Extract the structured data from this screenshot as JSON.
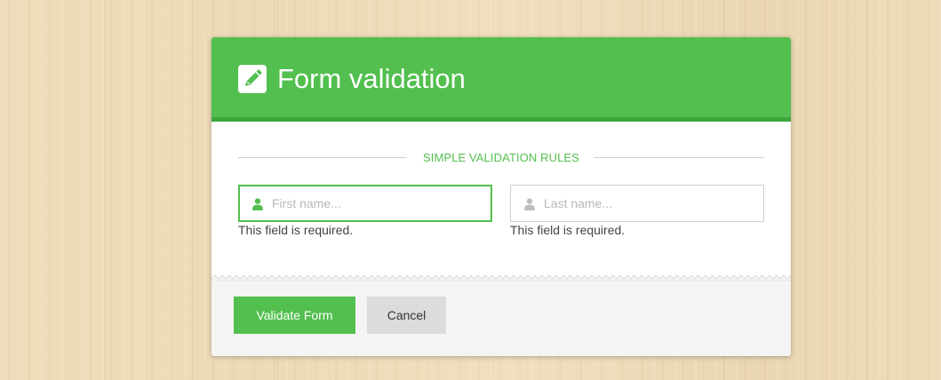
{
  "header": {
    "title": "Form validation",
    "icon": "pencil-square-icon"
  },
  "section": {
    "label": "SIMPLE VALIDATION RULES"
  },
  "fields": {
    "first_name": {
      "placeholder": "First name...",
      "value": "",
      "icon": "user-icon",
      "error": "This field is required."
    },
    "last_name": {
      "placeholder": "Last name...",
      "value": "",
      "icon": "user-icon",
      "error": "This field is required."
    }
  },
  "footer": {
    "validate_label": "Validate Form",
    "cancel_label": "Cancel"
  },
  "colors": {
    "accent": "#52bf4e",
    "accent_dark": "#3ea43b",
    "footer_bg": "#f4f4f4",
    "cancel_bg": "#dcdcdc",
    "background": "#ecd9b6"
  }
}
